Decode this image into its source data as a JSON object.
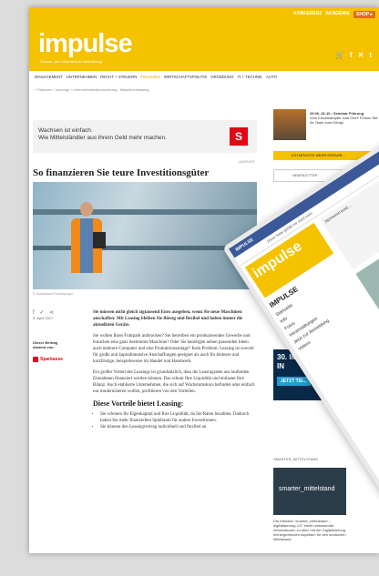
{
  "header": {
    "topnav": [
      "KONFERENZ",
      "AKADEMIE"
    ],
    "shop": "SHOP ▸",
    "logo": "impulse",
    "tagline": "Wissen, das Unternehmer weiterbringt"
  },
  "nav": [
    "MANAGEMENT",
    "UNTERNEHMEN",
    "RECHT + STEUERN",
    "FINANZEN",
    "WIRTSCHAFTSPOLITIK",
    "GRÜNDUNG",
    "IT + TECHNIK",
    "AUTO"
  ],
  "nav_active": "FINANZEN",
  "breadcrumb": "› Finanzen › Vorsorge › Unternehmensfinanzierung › Maschinenleasing",
  "ad": {
    "line1": "Wachsen ist einfach.",
    "line2": "Wie Mittelständler aus ihrem Geld mehr machen.",
    "logo": "S",
    "label": "ANZEIGE"
  },
  "article": {
    "title": "So finanzieren Sie teure Investitionsgüter",
    "caption": "© Sparkassen Finanzgruppe",
    "date": "5. April 2017",
    "sponsor_label": "Dieser Beitrag stammt von:",
    "sponsor_name": "Sparkasse",
    "lead": "Sie müssen nicht gleich zigtausend Euro ausgeben, wenn Sie neue Maschinen anschaffen: Mit Leasing bleiben Sie flüssig und flexibel und haben immer die aktuellsten Geräte.",
    "p1": "Sie wollen Ihren Fuhrpark aufstocken? Sie betreiben ein produzierendes Gewerbe und brauchen eine ganz bestimmte Maschine? Oder Sie benötigen neben passenden Ideen auch mehrere Computer und eine Produktionsanlage? Kein Problem: Leasing ist sowohl für große und kapitalintensive Anschaffungen geeignet als auch für kleinere und kurzfristige, beispielsweise im Handel und Handwerk.",
    "p2": "Ein großer Vorteil des Leasings ist grundsätzlich, dass die Leasingraten aus laufenden Einnahmen finanziert werden können. Das schont Ihre Liquidität und entlastet Ihre Bilanz. Auch etablierte Unternehmen, die sich auf Wachstumskurs befinden oder einfach nur modernisieren wollen, profitieren von den Vorteilen.",
    "h2": "Diese Vorteile bietet Leasing:",
    "li1": "Sie schonen Ihr Eigenkapital und Ihre Liquidität, da Sie Raten bezahlen. Dadurch haben Sie mehr finanziellen Spielraum für andere Investitionen.",
    "li2": "Sie können den Leasingvertrag individuell und flexibel an"
  },
  "sidebar": {
    "event": "29.06.-01.10.: Seminar Führung",
    "event_text": "Vom Einzelkämpfer zum Chef: Führen Sie Ihr Team zum Erfolg!",
    "cta": "ICH MÖCHTE MEHR ERFAHR...",
    "newsletter": "NEWSLETTER",
    "promo_big": "30. IMPULSE IN",
    "promo_btn": "JETZT TEI...",
    "sm_label": "SMARTER_MITTELSTAND",
    "sm_brand": "smarter_mittelstand",
    "sm_text": "Die Initiative \"smarter_mittelstand – digitalisierung 4.0\" bietet umfassende Informationen zu allen mit der Digitalisierung einhergehenden Aspekten für den deutschen Mittelstand."
  },
  "tablet": {
    "bar": "IMPULSE",
    "sub": "Diese Seite gefällt mir nicht mehr",
    "logo": "impulse",
    "name": "IMPULSE",
    "nav": [
      "Startseite",
      "Info",
      "Fotos",
      "Veranstaltungen",
      "Jetzt zur Anmeldung",
      "Videos"
    ],
    "post": "[sponsored post] ..."
  },
  "colors": {
    "brand": "#f5c200",
    "sparkasse": "#e30613",
    "facebook": "#3b5998"
  }
}
